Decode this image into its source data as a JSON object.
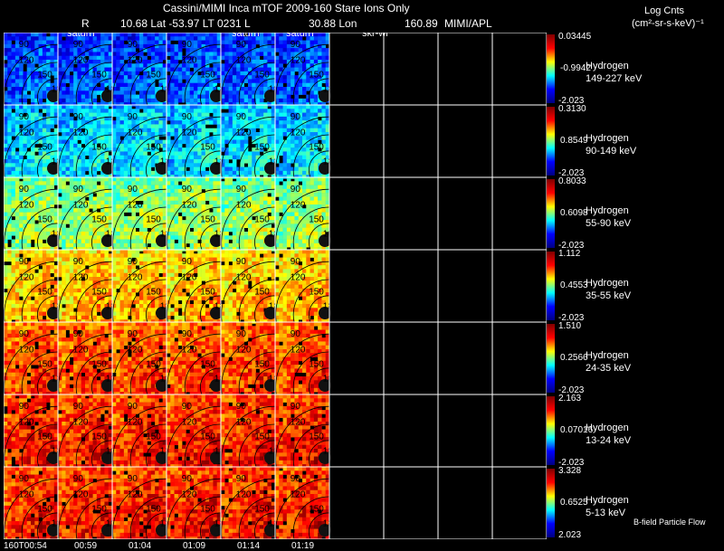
{
  "header": {
    "title": "Cassini/MIMI Inca mTOF  2009-160   Stare   Ions Only",
    "r_label": "R",
    "coords": "10.68 Lat -53.97 LT 0231 L",
    "l_value": "30.88 Lon",
    "lon_value": "160.89",
    "org": "MIMI/APL",
    "units_title": "Log Cnts",
    "units": "(cm²-sr-s-keV)⁻¹"
  },
  "overlay_labels": {
    "saturn": "saturn",
    "skr": "skr-wl",
    "contours": [
      "90",
      "120",
      "150",
      "18"
    ]
  },
  "channels": [
    {
      "species": "Hydrogen",
      "energy": "149-227 keV",
      "max": "0.03445",
      "mid": "-0.9942",
      "min": "-2.023"
    },
    {
      "species": "Hydrogen",
      "energy": "90-149 keV",
      "max": "0.3130",
      "mid": "0.8549",
      "min": "-2.023"
    },
    {
      "species": "Hydrogen",
      "energy": "55-90 keV",
      "max": "0.8033",
      "mid": "0.6098",
      "min": "-2.023"
    },
    {
      "species": "Hydrogen",
      "energy": "35-55 keV",
      "max": "1.112",
      "mid": "0.4553",
      "min": "-2.023"
    },
    {
      "species": "Hydrogen",
      "energy": "24-35 keV",
      "max": "1.510",
      "mid": "0.2566",
      "min": "-2.023"
    },
    {
      "species": "Hydrogen",
      "energy": "13-24 keV",
      "max": "2.163",
      "mid": "0.07016",
      "min": "-2.023"
    },
    {
      "species": "Hydrogen",
      "energy": "5-13 keV",
      "max": "3.328",
      "mid": "0.6525",
      "min": "2.023"
    }
  ],
  "channel_levels": [
    0.18,
    0.32,
    0.5,
    0.66,
    0.78,
    0.82,
    0.82
  ],
  "time_labels": [
    "160T00:54",
    "00:59",
    "01:04",
    "01:09",
    "01:14",
    "01:19"
  ],
  "footer_note": "B-field Particle Flow"
}
